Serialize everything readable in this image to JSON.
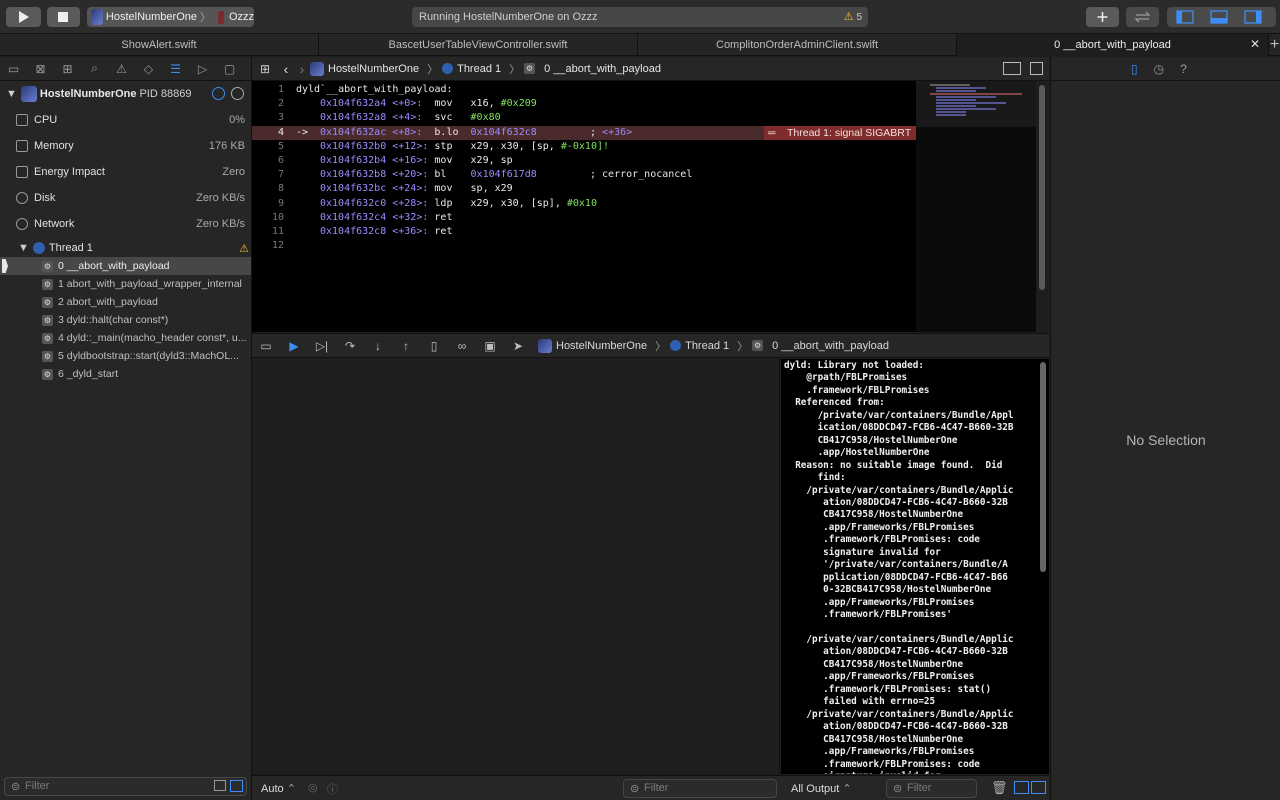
{
  "toolbar": {
    "scheme_app": "HostelNumberOne",
    "scheme_device": "Ozzz",
    "activity_status": "Running HostelNumberOne on Ozzz",
    "warning_count": "5"
  },
  "tabs": [
    {
      "label": "ShowAlert.swift"
    },
    {
      "label": "BascetUserTableViewController.swift"
    },
    {
      "label": "ComplitonOrderAdminClient.swift"
    },
    {
      "label": "0 __abort_with_payload"
    }
  ],
  "navigator": {
    "process_name": "HostelNumberOne",
    "process_pid": "PID 88869",
    "gauges": [
      {
        "label": "CPU",
        "value": "0%"
      },
      {
        "label": "Memory",
        "value": "176 KB"
      },
      {
        "label": "Energy Impact",
        "value": "Zero"
      },
      {
        "label": "Disk",
        "value": "Zero KB/s"
      },
      {
        "label": "Network",
        "value": "Zero KB/s"
      }
    ],
    "thread_label": "Thread 1",
    "frames": [
      "0 __abort_with_payload",
      "1 abort_with_payload_wrapper_internal",
      "2 abort_with_payload",
      "3 dyld::halt(char const*)",
      "4 dyld::_main(macho_header const*, u...",
      "5 dyldbootstrap::start(dyld3::MachOL...",
      "6 _dyld_start"
    ],
    "filter_placeholder": "Filter"
  },
  "jumpbar": {
    "project": "HostelNumberOne",
    "thread": "Thread 1",
    "frame": "0 __abort_with_payload"
  },
  "editor": {
    "lines": [
      {
        "n": "1",
        "text": "dyld`__abort_with_payload:"
      },
      {
        "n": "2",
        "addr": "0x104f632a4",
        "off": "<+0>:",
        "op": "mov",
        "args": "x16, ",
        "imm": "#0x209"
      },
      {
        "n": "3",
        "addr": "0x104f632a8",
        "off": "<+4>:",
        "op": "svc",
        "args": "",
        "imm": "#0x80"
      },
      {
        "n": "4",
        "addr": "0x104f632ac",
        "off": "<+8>:",
        "op": "b.lo",
        "args": "0x104f632c8",
        "comment": "; <+36>"
      },
      {
        "n": "5",
        "addr": "0x104f632b0",
        "off": "<+12>:",
        "op": "stp",
        "args": "x29, x30, [sp, ",
        "imm": "#-0x10",
        "tail": "]!"
      },
      {
        "n": "6",
        "addr": "0x104f632b4",
        "off": "<+16>:",
        "op": "mov",
        "args": "x29, sp"
      },
      {
        "n": "7",
        "addr": "0x104f632b8",
        "off": "<+20>:",
        "op": "bl",
        "args": "0x104f617d8",
        "comment": "; cerror_nocancel"
      },
      {
        "n": "8",
        "addr": "0x104f632bc",
        "off": "<+24>:",
        "op": "mov",
        "args": "sp, x29"
      },
      {
        "n": "9",
        "addr": "0x104f632c0",
        "off": "<+28>:",
        "op": "ldp",
        "args": "x29, x30, [sp], ",
        "imm": "#0x10"
      },
      {
        "n": "10",
        "addr": "0x104f632c4",
        "off": "<+32>:",
        "op": "ret",
        "args": ""
      },
      {
        "n": "11",
        "addr": "0x104f632c8",
        "off": "<+36>:",
        "op": "ret",
        "args": ""
      },
      {
        "n": "12",
        "text": ""
      }
    ],
    "current_arrow": "->",
    "error_banner": "Thread 1: signal SIGABRT"
  },
  "debugbar": {
    "project": "HostelNumberOne",
    "thread": "Thread 1",
    "frame": "0 __abort_with_payload"
  },
  "console": {
    "lines": [
      "dyld: Library not loaded:",
      "    @rpath/FBLPromises",
      "    .framework/FBLPromises",
      "  Referenced from:",
      "      /private/var/containers/Bundle/Appl",
      "      ication/08DDCD47-FCB6-4C47-B660-32B",
      "      CB417C958/HostelNumberOne",
      "      .app/HostelNumberOne",
      "  Reason: no suitable image found.  Did",
      "      find:",
      "    /private/var/containers/Bundle/Applic",
      "       ation/08DDCD47-FCB6-4C47-B660-32B",
      "       CB417C958/HostelNumberOne",
      "       .app/Frameworks/FBLPromises",
      "       .framework/FBLPromises: code",
      "       signature invalid for",
      "       '/private/var/containers/Bundle/A",
      "       pplication/08DDCD47-FCB6-4C47-B66",
      "       0-32BCB417C958/HostelNumberOne",
      "       .app/Frameworks/FBLPromises",
      "       .framework/FBLPromises'",
      "",
      "    /private/var/containers/Bundle/Applic",
      "       ation/08DDCD47-FCB6-4C47-B660-32B",
      "       CB417C958/HostelNumberOne",
      "       .app/Frameworks/FBLPromises",
      "       .framework/FBLPromises: stat()",
      "       failed with errno=25",
      "    /private/var/containers/Bundle/Applic",
      "       ation/08DDCD47-FCB6-4C47-B660-32B",
      "       CB417C958/HostelNumberOne",
      "       .app/Frameworks/FBLPromises",
      "       .framework/FBLPromises: code",
      "       signature invalid for"
    ]
  },
  "footer": {
    "auto_label": "Auto",
    "vars_filter_placeholder": "Filter",
    "output_label": "All Output",
    "console_filter_placeholder": "Filter"
  },
  "inspector": {
    "empty_label": "No Selection"
  }
}
